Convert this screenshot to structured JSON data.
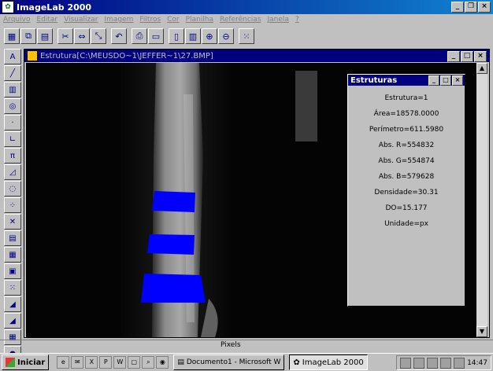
{
  "app": {
    "title": "ImageLab 2000"
  },
  "menu": [
    "Arquivo",
    "Editar",
    "Visualizar",
    "Imagem",
    "Filtros",
    "Cor",
    "Planilha",
    "Referências",
    "Janela",
    "?"
  ],
  "toolbar_icons": [
    "grid-icon",
    "copy-icon",
    "paste-icon",
    "scissors-icon",
    "flip-icon",
    "resize-icon",
    "undo-icon",
    "print-icon",
    "screen-icon",
    "document-icon",
    "chart-icon",
    "zoom-in-icon",
    "zoom-out-icon",
    "dots-icon"
  ],
  "left_tools": [
    {
      "icon": "text-tool-icon",
      "glyph": "A"
    },
    {
      "icon": "line-tool-icon",
      "glyph": "╱"
    },
    {
      "icon": "bars-tool-icon",
      "glyph": "▥"
    },
    {
      "icon": "target-tool-icon",
      "glyph": "◎"
    },
    {
      "icon": "point-tool-icon",
      "glyph": "·"
    },
    {
      "icon": "angle-tool-icon",
      "glyph": "∟"
    },
    {
      "icon": "pi-tool-icon",
      "glyph": "π"
    },
    {
      "icon": "polygon-tool-icon",
      "glyph": "◿"
    },
    {
      "icon": "ellipse-tool-icon",
      "glyph": "◌"
    },
    {
      "icon": "spray-tool-icon",
      "glyph": "⁘"
    },
    {
      "icon": "cross-tool-icon",
      "glyph": "✕"
    },
    {
      "icon": "histogram-tool-icon",
      "glyph": "▤"
    },
    {
      "icon": "grid-tool-icon",
      "glyph": "▦"
    },
    {
      "icon": "stamp-tool-icon",
      "glyph": "▣"
    },
    {
      "icon": "scatter-tool-icon",
      "glyph": "⁙"
    },
    {
      "icon": "ramp-tool-icon",
      "glyph": "◢"
    },
    {
      "icon": "ramp2-tool-icon",
      "glyph": "◢"
    },
    {
      "icon": "table-tool-icon",
      "glyph": "▦"
    },
    {
      "icon": "globe-tool-icon",
      "glyph": "●"
    }
  ],
  "child_window": {
    "title": "Estrutura[C:\\MEUSDO~1\\JEFFER~1\\27.BMP]"
  },
  "dialog": {
    "title": "Estruturas",
    "lines": [
      "Estrutura=1",
      "Área=18578.0000",
      "Perímetro=611.5980",
      "Abs. R=554832",
      "Abs. G=554874",
      "Abs. B=579628",
      "Densidade=30.31",
      "DO=15.177",
      "Unidade=px"
    ]
  },
  "status": {
    "units": "Pixels"
  },
  "taskbar": {
    "start": "Iniciar",
    "tasks": [
      {
        "label": "Documento1 - Microsoft W"
      },
      {
        "label": "ImageLab 2000"
      }
    ],
    "clock": "14:47"
  },
  "colors": {
    "title_bar": "#000080",
    "selection": "#0000ff"
  }
}
